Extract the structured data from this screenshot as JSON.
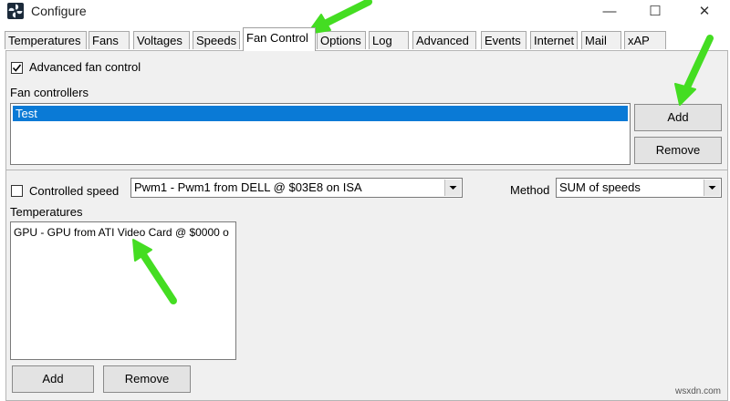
{
  "window": {
    "title": "Configure",
    "minimize": "—",
    "maximize": "☐",
    "close": "✕"
  },
  "tabs": [
    {
      "label": "Temperatures",
      "active": false
    },
    {
      "label": "Fans",
      "active": false
    },
    {
      "label": "Voltages",
      "active": false
    },
    {
      "label": "Speeds",
      "active": false
    },
    {
      "label": "Fan Control",
      "active": true
    },
    {
      "label": "Options",
      "active": false
    },
    {
      "label": "Log",
      "active": false
    },
    {
      "label": "Advanced",
      "active": false
    },
    {
      "label": "Events",
      "active": false
    },
    {
      "label": "Internet",
      "active": false
    },
    {
      "label": "Mail",
      "active": false
    },
    {
      "label": "xAP",
      "active": false
    }
  ],
  "advanced_fan_control": {
    "label": "Advanced fan control",
    "checked": true
  },
  "fan_controllers": {
    "title": "Fan controllers",
    "items": [
      "Test"
    ],
    "selected": "Test",
    "add_label": "Add",
    "remove_label": "Remove"
  },
  "controlled_speed": {
    "label": "Controlled speed",
    "checked": false,
    "value": "Pwm1 - Pwm1 from DELL @ $03E8 on ISA"
  },
  "method": {
    "label": "Method",
    "value": "SUM of speeds"
  },
  "temperatures": {
    "title": "Temperatures",
    "items": [
      "GPU - GPU from ATI Video Card @ $0000 o"
    ],
    "add_label": "Add",
    "remove_label": "Remove"
  },
  "annotation_color": "#44dd22",
  "watermark": "wsxdn.com"
}
